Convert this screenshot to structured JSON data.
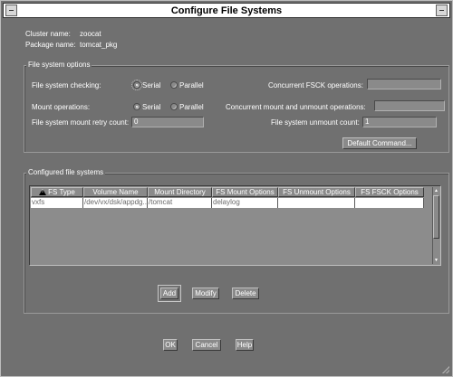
{
  "window": {
    "title": "Configure File Systems"
  },
  "info": {
    "cluster_label": "Cluster name:",
    "cluster_value": "zoocat",
    "package_label": "Package name:",
    "package_value": "tomcat_pkg"
  },
  "fs_options": {
    "title": "File system options",
    "checking_label": "File system checking:",
    "checking_serial": "Serial",
    "checking_parallel": "Parallel",
    "checking_selected": "Serial",
    "mount_label": "Mount operations:",
    "mount_serial": "Serial",
    "mount_parallel": "Parallel",
    "mount_selected": "Serial",
    "retry_label": "File system mount retry count:",
    "retry_value": "0",
    "fsck_label": "Concurrent FSCK operations:",
    "fsck_value": "",
    "concurrent_mount_label": "Concurrent mount and unmount operations:",
    "concurrent_mount_value": "",
    "unmount_label": "File system unmount count:",
    "unmount_value": "1",
    "default_command_label": "Default Command..."
  },
  "configured": {
    "title": "Configured file systems",
    "columns": [
      "FS Type",
      "Volume Name",
      "Mount Directory",
      "FS Mount Options",
      "FS Unmount Options",
      "FS FSCK Options"
    ],
    "rows": [
      [
        "vxfs",
        "/dev/vx/dsk/appdg...",
        "/tomcat",
        "delaylog",
        "",
        ""
      ]
    ],
    "add_label": "Add",
    "modify_label": "Modify",
    "delete_label": "Delete"
  },
  "footer": {
    "ok_label": "OK",
    "cancel_label": "Cancel",
    "help_label": "Help"
  },
  "colors": {
    "background": "#707070",
    "field": "#8a8a8a",
    "titlebar": "#ffffff",
    "row_highlight": "#ffffff"
  },
  "icons": {
    "fs_type_header": "warning-icon"
  }
}
